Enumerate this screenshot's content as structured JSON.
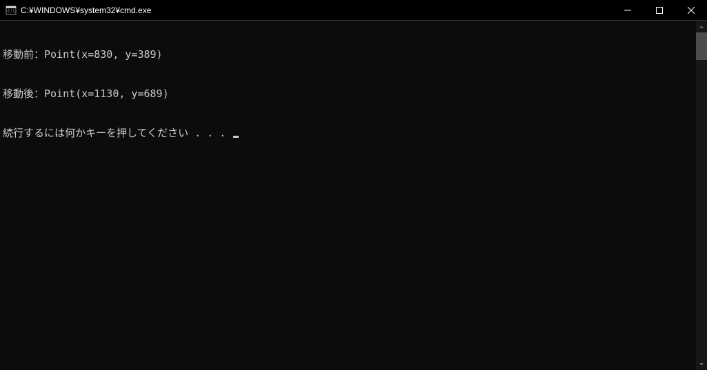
{
  "window": {
    "title": "C:¥WINDOWS¥system32¥cmd.exe"
  },
  "console": {
    "lines": [
      "移動前：Point(x=830, y=389)",
      "移動後：Point(x=1130, y=689)",
      "続行するには何かキーを押してください . . . "
    ]
  }
}
